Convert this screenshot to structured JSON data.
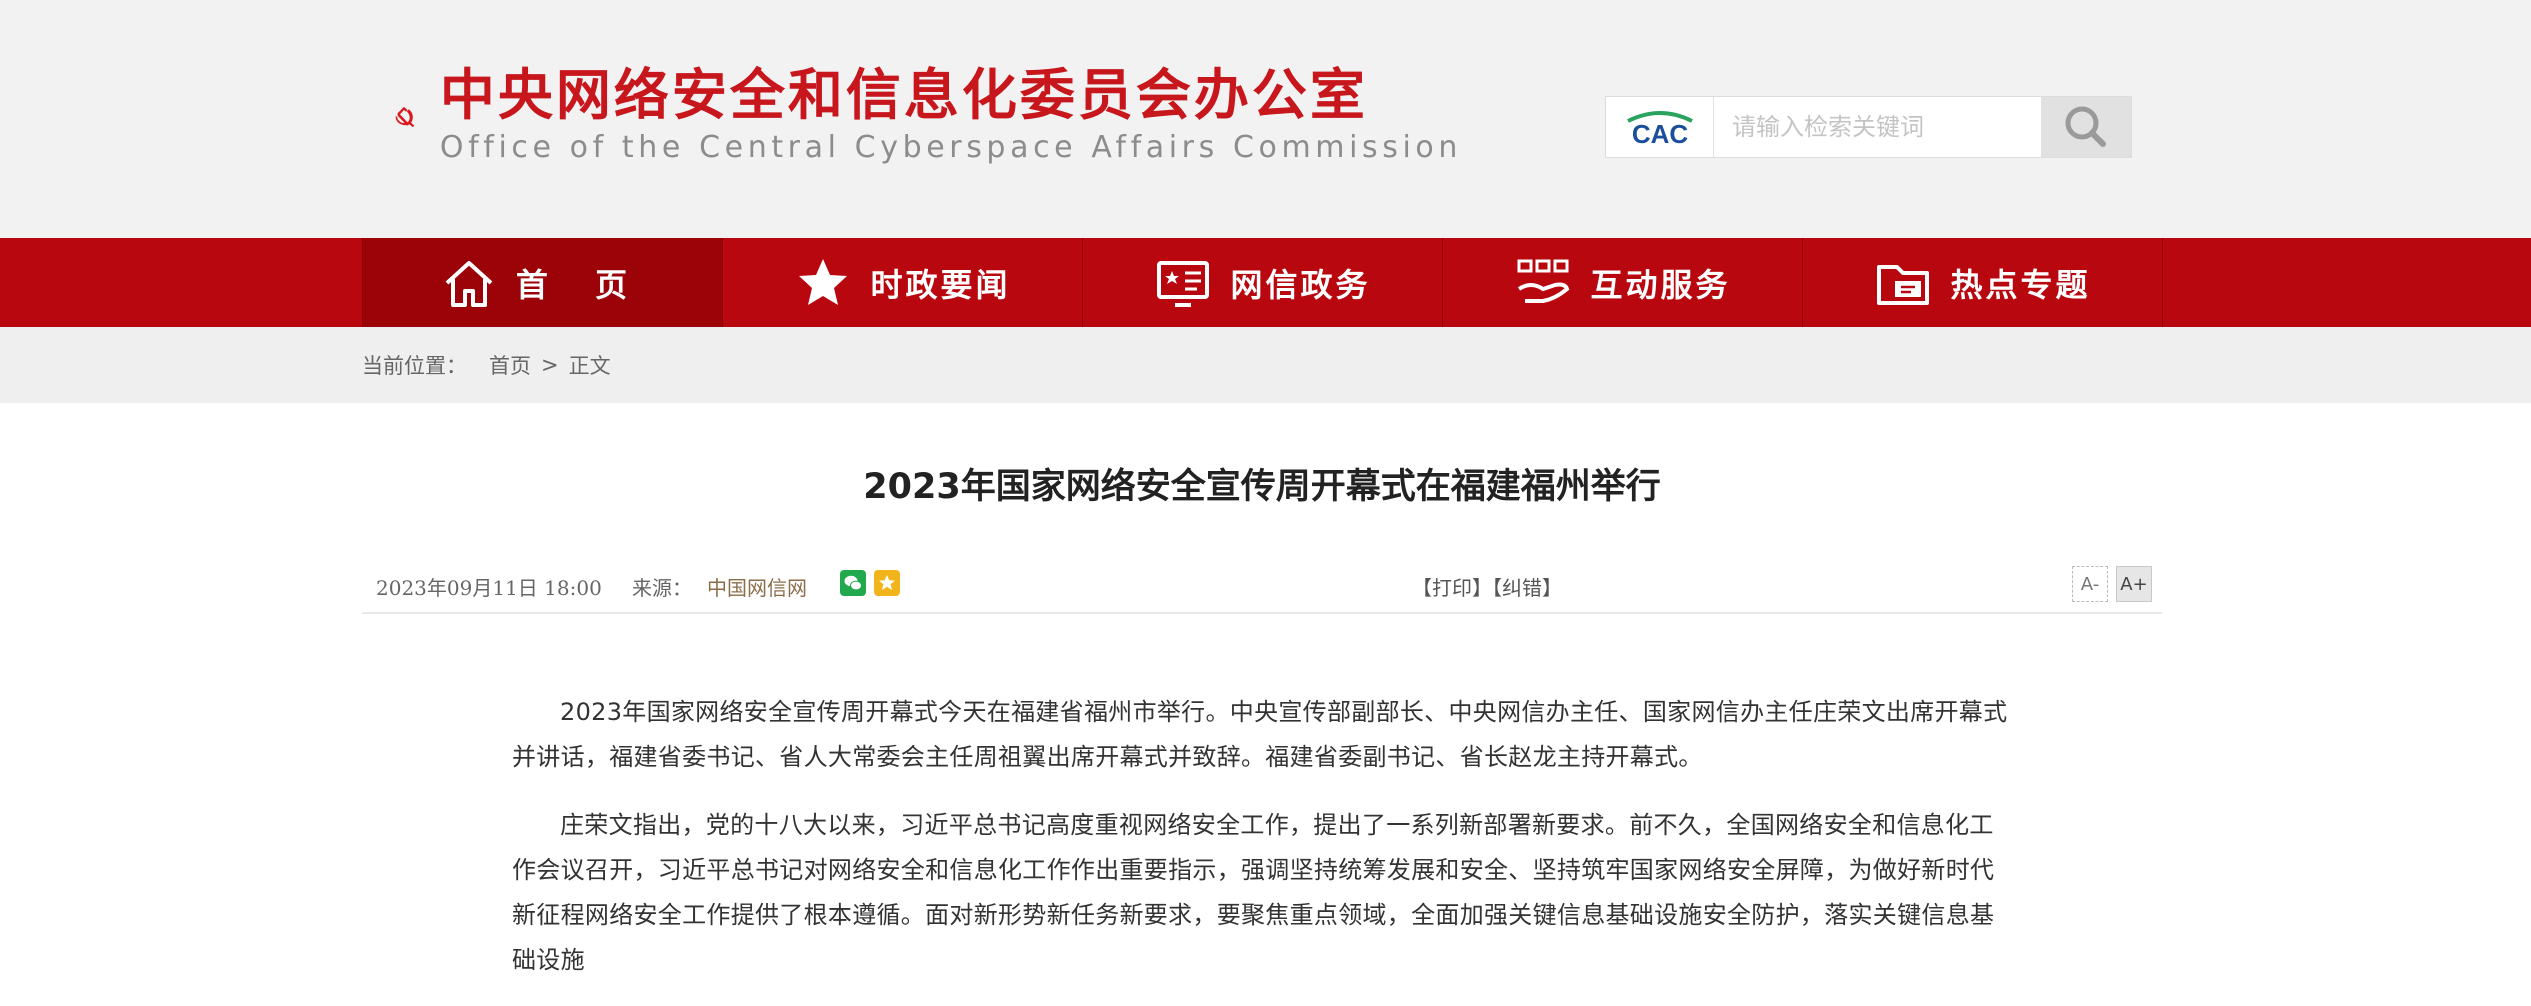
{
  "header": {
    "title_cn": "中央网络安全和信息化委员会办公室",
    "title_en": "Office of the Central Cyberspace Affairs Commission",
    "brand_color": "#c8161d",
    "search": {
      "badge": "CAC",
      "placeholder": "请输入检索关键词",
      "button_icon": "search-icon"
    }
  },
  "nav": {
    "color": "#b8070e",
    "items": [
      {
        "label": "首 页",
        "icon": "home-icon"
      },
      {
        "label": "时政要闻",
        "icon": "star-icon"
      },
      {
        "label": "网信政务",
        "icon": "board-icon"
      },
      {
        "label": "互动服务",
        "icon": "service-icon"
      },
      {
        "label": "热点专题",
        "icon": "folder-icon"
      }
    ]
  },
  "breadcrumb": {
    "prefix": "当前位置：",
    "home": "首页",
    "separator": ">",
    "current": "正文"
  },
  "article": {
    "title": "2023年国家网络安全宣传周开幕式在福建福州举行",
    "date": "2023年09月11日  18:00",
    "source_label": "来源：",
    "source": "中国网信网",
    "share_icons": [
      "wechat-icon",
      "qzone-icon"
    ],
    "print_label": "【打印】",
    "correct_label": "【纠错】",
    "font_minus": "A-",
    "font_plus": "A+",
    "paragraphs": [
      "2023年国家网络安全宣传周开幕式今天在福建省福州市举行。中央宣传部副部长、中央网信办主任、国家网信办主任庄荣文出席开幕式并讲话，福建省委书记、省人大常委会主任周祖翼出席开幕式并致辞。福建省委副书记、省长赵龙主持开幕式。",
      "庄荣文指出，党的十八大以来，习近平总书记高度重视网络安全工作，提出了一系列新部署新要求。前不久，全国网络安全和信息化工作会议召开，习近平总书记对网络安全和信息化工作作出重要指示，强调坚持统筹发展和安全、坚持筑牢国家网络安全屏障，为做好新时代新征程网络安全工作提供了根本遵循。面对新形势新任务新要求，要聚焦重点领域，全面加强关键信息基础设施安全防护，落实关键信息基础设施"
    ]
  }
}
